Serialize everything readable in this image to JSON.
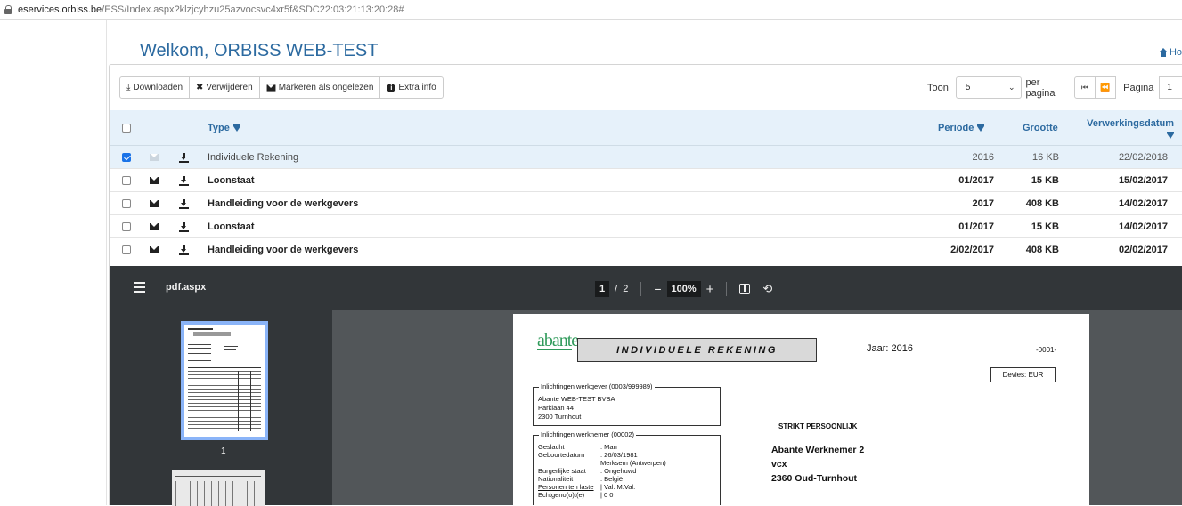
{
  "browser": {
    "url_host": "eservices.orbiss.be",
    "url_path": "/ESS/Index.aspx?klzjcyhzu25azvocsvc4xr5f&SDC22:03:21:13:20:28#"
  },
  "header": {
    "title": "Welkom, ORBISS WEB-TEST",
    "home_label": "Ho"
  },
  "toolbar": {
    "download_label": "Downloaden",
    "delete_label": "Verwijderen",
    "mark_unread_label": "Markeren als ongelezen",
    "extra_info_label": "Extra info"
  },
  "pager": {
    "show_label": "Toon",
    "per_page_value": "5",
    "per_page_label": "per pagina",
    "page_label": "Pagina",
    "page_value": "1"
  },
  "table": {
    "headers": {
      "type": "Type",
      "period": "Periode",
      "size": "Grootte",
      "processing_date": "Verwerkingsdatum"
    },
    "rows": [
      {
        "type": "Individuele Rekening",
        "period": "2016",
        "size": "16 KB",
        "date": "22/02/2018",
        "selected": true
      },
      {
        "type": "Loonstaat",
        "period": "01/2017",
        "size": "15 KB",
        "date": "15/02/2017",
        "selected": false
      },
      {
        "type": "Handleiding voor de werkgevers",
        "period": "2017",
        "size": "408 KB",
        "date": "14/02/2017",
        "selected": false
      },
      {
        "type": "Loonstaat",
        "period": "01/2017",
        "size": "15 KB",
        "date": "14/02/2017",
        "selected": false
      },
      {
        "type": "Handleiding voor de werkgevers",
        "period": "2/02/2017",
        "size": "408 KB",
        "date": "02/02/2017",
        "selected": false
      }
    ]
  },
  "pdf_viewer": {
    "file_name": "pdf.aspx",
    "current_page": "1",
    "page_sep": "/",
    "total_pages": "2",
    "zoom_minus": "−",
    "zoom": "100%",
    "zoom_plus": "+",
    "thumb_page": "1"
  },
  "document": {
    "logo": "abante",
    "heading": "INDIVIDUELE REKENING",
    "year": "Jaar: 2016",
    "code": "-0001-",
    "currency": "Devies: EUR",
    "employer_legend": "Inlichtingen werkgever  (0003/999989)",
    "employer_lines": [
      "Abante WEB-TEST BVBA",
      "Parklaan 44",
      "2300 Turnhout"
    ],
    "employee_legend": "Inlichtingen werknemer  (00002)",
    "employee_fields": [
      {
        "k": "Geslacht",
        "v": ": Man"
      },
      {
        "k": "Geboortedatum",
        "v": ": 26/03/1981"
      },
      {
        "k": "",
        "v": "  Merksem (Antwerpen)"
      },
      {
        "k": "Burgerlijke staat",
        "v": ": Ongehuwd"
      },
      {
        "k": "Nationaliteit",
        "v": ": België"
      },
      {
        "k": "Personen ten laste",
        "v": "| Val.    M.Val."
      },
      {
        "k": "Echtgeno(o)t(e)",
        "v": "|  0        0"
      }
    ],
    "strikt": "STRIKT PERSOONLIJK",
    "recipient_lines": [
      "Abante Werknemer 2",
      "vcx",
      "2360 Oud-Turnhout"
    ]
  },
  "colors": {
    "accent": "#2c6aa0",
    "header_bg": "#e6f1fa",
    "viewer_bar": "#323639",
    "viewer_bg": "#525659",
    "logo_green": "#2f9a5a"
  }
}
